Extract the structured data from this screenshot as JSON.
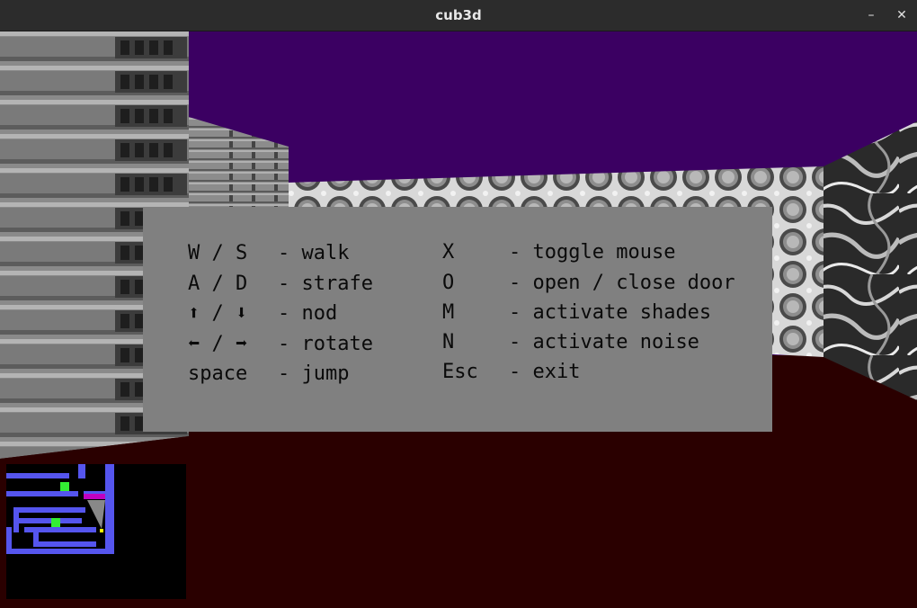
{
  "window": {
    "title": "cub3d",
    "minimize_glyph": "–",
    "close_glyph": "✕"
  },
  "help_overlay": {
    "left_column": [
      {
        "keys": "W / S",
        "sep": "-",
        "action": "walk"
      },
      {
        "keys": "A / D",
        "sep": "-",
        "action": "strafe"
      },
      {
        "keys": "⬆ / ⬇",
        "sep": "-",
        "action": "nod"
      },
      {
        "keys": "⬅ / ➡",
        "sep": "-",
        "action": "rotate"
      },
      {
        "keys": "space",
        "sep": "-",
        "action": "jump"
      }
    ],
    "right_column": [
      {
        "key": "X",
        "sep": "-",
        "action": "toggle mouse"
      },
      {
        "key": "O",
        "sep": "-",
        "action": "open / close door"
      },
      {
        "key": "M",
        "sep": "-",
        "action": "activate shades"
      },
      {
        "key": "N",
        "sep": "-",
        "action": "activate noise"
      },
      {
        "key": "Esc",
        "sep": "-",
        "action": "exit"
      }
    ]
  },
  "colors": {
    "ceiling": "#3b0062",
    "floor": "#2a0000",
    "overlay_bg": "#808080",
    "minimap_wall": "#5555ee",
    "minimap_marker": "#33ee33",
    "minimap_door": "#c000c0",
    "minimap_player": "#ffff00"
  },
  "icons": {
    "minimize": "minimize-icon",
    "close": "close-icon"
  }
}
